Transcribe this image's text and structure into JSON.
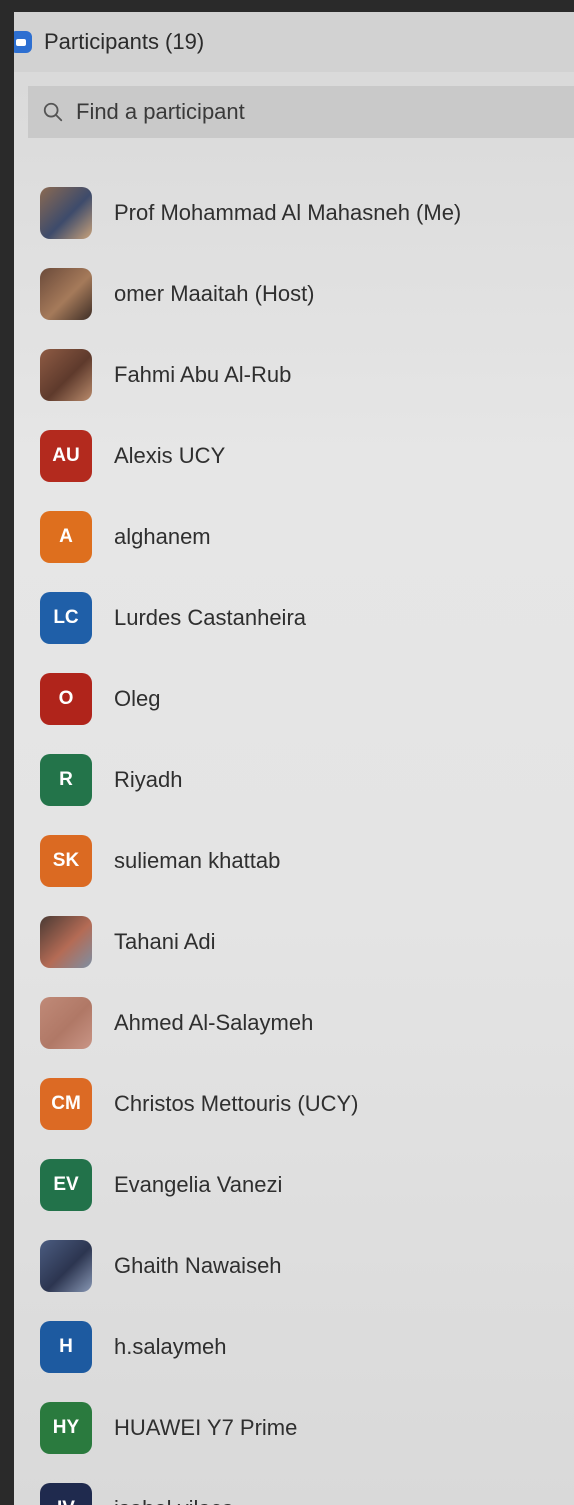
{
  "header": {
    "title": "Participants (19)"
  },
  "search": {
    "placeholder": "Find a participant"
  },
  "participants": [
    {
      "name": "Prof Mohammad Al Mahasneh (Me)",
      "avatar": {
        "type": "photo",
        "colors": [
          "#8b6a52",
          "#3d4b6b",
          "#c9a27a"
        ]
      }
    },
    {
      "name": "omer Maaitah (Host)",
      "avatar": {
        "type": "photo",
        "colors": [
          "#6b4a3a",
          "#a57a5a",
          "#3e2e26"
        ]
      }
    },
    {
      "name": "Fahmi Abu Al-Rub",
      "avatar": {
        "type": "photo",
        "colors": [
          "#8e5b44",
          "#5e3a2c",
          "#b98b6c"
        ]
      }
    },
    {
      "name": "Alexis UCY",
      "avatar": {
        "type": "initials",
        "initials": "AU",
        "color": "#b32a1e"
      }
    },
    {
      "name": "alghanem",
      "avatar": {
        "type": "initials",
        "initials": "A",
        "color": "#de6f1e"
      }
    },
    {
      "name": "Lurdes Castanheira",
      "avatar": {
        "type": "initials",
        "initials": "LC",
        "color": "#1f5fa8"
      }
    },
    {
      "name": "Oleg",
      "avatar": {
        "type": "initials",
        "initials": "O",
        "color": "#b0241b"
      }
    },
    {
      "name": "Riyadh",
      "avatar": {
        "type": "initials",
        "initials": "R",
        "color": "#23744a"
      }
    },
    {
      "name": "sulieman khattab",
      "avatar": {
        "type": "initials",
        "initials": "SK",
        "color": "#db6a22"
      }
    },
    {
      "name": "Tahani Adi",
      "avatar": {
        "type": "photo",
        "colors": [
          "#4a3a34",
          "#b46b55",
          "#7d8fa3"
        ]
      }
    },
    {
      "name": "Ahmed Al-Salaymeh",
      "avatar": {
        "type": "photo",
        "colors": [
          "#c08a78",
          "#b07866",
          "#c99586"
        ]
      }
    },
    {
      "name": "Christos Mettouris (UCY)",
      "avatar": {
        "type": "initials",
        "initials": "CM",
        "color": "#dc6a24"
      }
    },
    {
      "name": "Evangelia Vanezi",
      "avatar": {
        "type": "initials",
        "initials": "EV",
        "color": "#22724a"
      }
    },
    {
      "name": "Ghaith Nawaiseh",
      "avatar": {
        "type": "photo",
        "colors": [
          "#4b5c80",
          "#2c3550",
          "#8897b4"
        ]
      }
    },
    {
      "name": "h.salaymeh",
      "avatar": {
        "type": "initials",
        "initials": "H",
        "color": "#1d5aa0"
      }
    },
    {
      "name": "HUAWEI Y7 Prime",
      "avatar": {
        "type": "initials",
        "initials": "HY",
        "color": "#2a7a3e"
      }
    },
    {
      "name": "isabel vilaça",
      "avatar": {
        "type": "initials",
        "initials": "IV",
        "color": "#1f2a4e"
      }
    }
  ]
}
